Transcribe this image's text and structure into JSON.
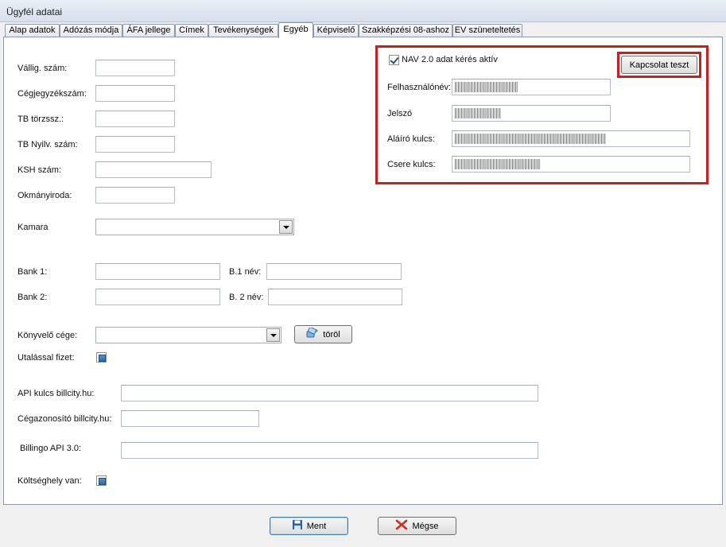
{
  "window": {
    "title": "Ügyfél adatai"
  },
  "tabs": [
    {
      "label": "Alap adatok",
      "active": false
    },
    {
      "label": "Adózás módja",
      "active": false
    },
    {
      "label": "ÁFA jellege",
      "active": false
    },
    {
      "label": "Címek",
      "active": false
    },
    {
      "label": "Tevékenységek",
      "active": false
    },
    {
      "label": "Egyéb",
      "active": true
    },
    {
      "label": "Képviselő",
      "active": false
    },
    {
      "label": "Szakképzési 08-ashoz",
      "active": false
    },
    {
      "label": "EV szüneteltetés",
      "active": false
    }
  ],
  "form": {
    "vallig_label": "Vállig. szám:",
    "vallig_value": "",
    "cegjegyzek_label": "Cégjegyzékszám:",
    "cegjegyzek_value": "",
    "tb_torzs_label": "TB törzssz.:",
    "tb_torzs_value": "",
    "tb_nyilv_label": "TB Nyilv. szám:",
    "tb_nyilv_value": "",
    "ksh_label": "KSH szám:",
    "ksh_value": "",
    "okmanyiroda_label": "Okmányiroda:",
    "okmanyiroda_value": "",
    "kamara_label": "Kamara",
    "kamara_value": "",
    "bank1_label": "Bank 1:",
    "bank1_value": "",
    "b1nev_label": "B.1 név:",
    "b1nev_value": "",
    "bank2_label": "Bank 2:",
    "bank2_value": "",
    "b2nev_label": "B. 2 név:",
    "b2nev_value": "",
    "konyvelo_label": "Könyvelő cége:",
    "konyvelo_value": "",
    "torol_label": "töröl",
    "utalassal_label": "Utalással fizet:",
    "api_billcity_label": "API kulcs billcity.hu:",
    "api_billcity_value": "",
    "cegazon_label": "Cégazonosító billcity.hu:",
    "cegazon_value": "",
    "billingo_label": "Billingo API 3.0:",
    "billingo_value": "",
    "koltseghely_label": "Költséghely van:"
  },
  "nav": {
    "checkbox_label": "NAV 2.0 adat kérés aktív",
    "test_button": "Kapcsolat teszt",
    "user_label": "Felhasználónév:",
    "password_label": "Jelszó",
    "sign_key_label": "Aláíró kulcs:",
    "exchange_key_label": "Csere kulcs:"
  },
  "footer": {
    "save_label": "Ment",
    "cancel_label": "Mégse"
  },
  "colors": {
    "highlight": "#d21b1b",
    "save_icon": "#2b5fa8",
    "cancel_icon": "#d42a20"
  },
  "icons": {
    "save": "floppy-disk-icon",
    "cancel": "red-x-icon",
    "clear": "eraser-icon"
  }
}
